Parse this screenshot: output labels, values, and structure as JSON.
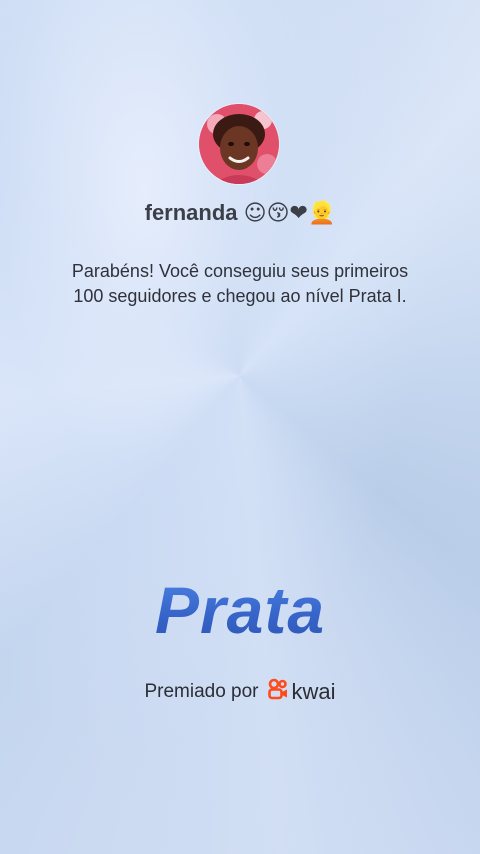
{
  "profile": {
    "username": "fernanda",
    "username_emojis": "☺😚❤👱"
  },
  "message": {
    "line1": "Parabéns! Você conseguiu seus primeiros",
    "line2": "100 seguidores e chegou ao nível Prata I."
  },
  "tier": {
    "name": "Prata"
  },
  "award": {
    "label": "Premiado por",
    "brand": "kwai",
    "brand_icon": "kwai-logo-icon",
    "brand_icon_color": "#ff4a1c"
  },
  "colors": {
    "tier_text": "#3f6fd1",
    "background": "#c3d5ee"
  }
}
